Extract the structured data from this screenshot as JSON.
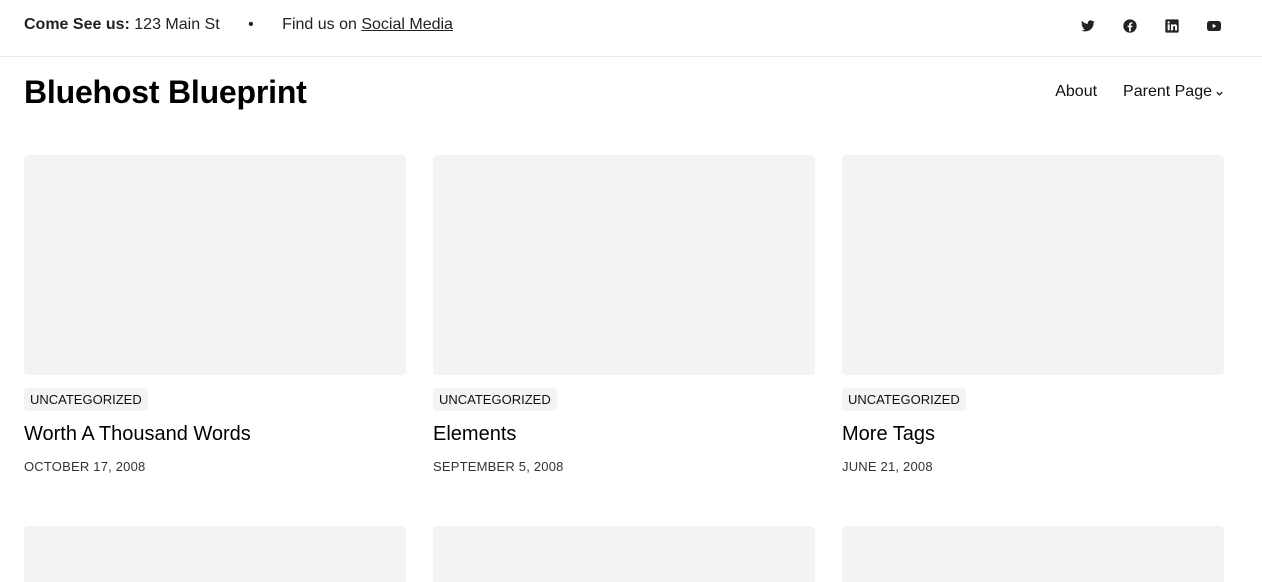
{
  "topbar": {
    "visit_label": "Come See us:",
    "address": "123 Main St",
    "separator": "•",
    "find_text": "Find us on",
    "social_link": "Social Media"
  },
  "social_icons": [
    "twitter-icon",
    "facebook-icon",
    "linkedin-icon",
    "youtube-icon"
  ],
  "site": {
    "title": "Bluehost Blueprint"
  },
  "nav": {
    "items": [
      {
        "label": "About"
      },
      {
        "label": "Parent Page"
      }
    ]
  },
  "posts": [
    {
      "category": "UNCATEGORIZED",
      "title": "Worth A Thousand Words",
      "date": "OCTOBER 17, 2008"
    },
    {
      "category": "UNCATEGORIZED",
      "title": "Elements",
      "date": "SEPTEMBER 5, 2008"
    },
    {
      "category": "UNCATEGORIZED",
      "title": "More Tags",
      "date": "JUNE 21, 2008"
    }
  ],
  "colors": {
    "placeholder": "#f3f3f3",
    "text": "#111111",
    "divider": "#ebebeb"
  }
}
